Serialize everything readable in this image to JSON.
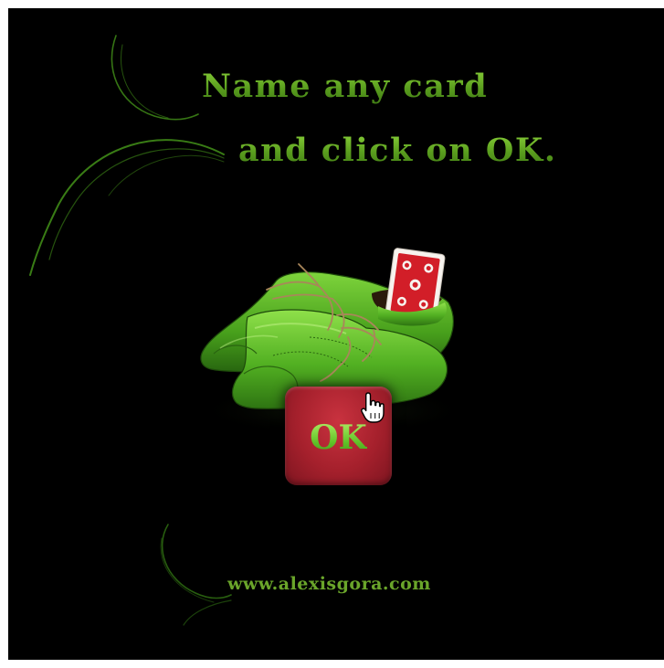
{
  "heading": {
    "line1": "Name any card",
    "line2": "and click on OK."
  },
  "button": {
    "ok_label": "OK"
  },
  "footer": {
    "website": "www.alexisgora.com"
  },
  "colors": {
    "background": "#000000",
    "accent_green": "#6aa52a",
    "button_red": "#a5202c"
  },
  "icons": {
    "illustration": "green-shoes-with-card-icon",
    "cursor": "hand-pointer-icon",
    "decoration": "green-swirl-icon"
  }
}
